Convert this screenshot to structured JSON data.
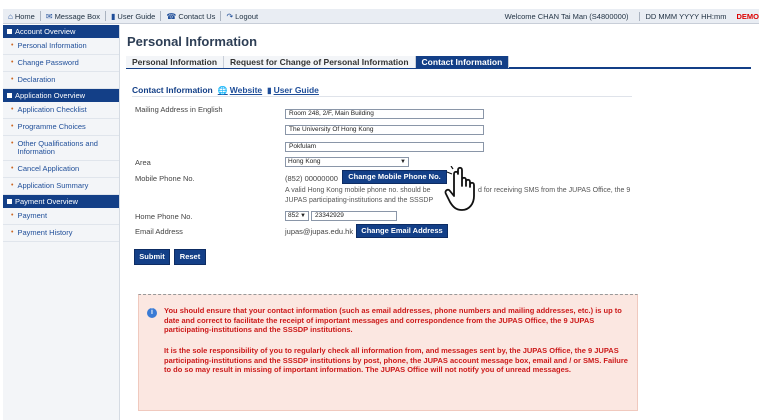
{
  "topbar": {
    "home": "Home",
    "message_box": "Message Box",
    "user_guide": "User Guide",
    "contact_us": "Contact Us",
    "logout": "Logout",
    "welcome": "Welcome CHAN Tai Man (S4800000)",
    "datetime": "DD MMM YYYY HH:mm",
    "demo": "DEMO"
  },
  "sidebar": {
    "sections": [
      {
        "title": "Account Overview",
        "items": [
          "Personal Information",
          "Change Password",
          "Declaration"
        ]
      },
      {
        "title": "Application Overview",
        "items": [
          "Application Checklist",
          "Programme Choices",
          "Other Qualifications and Information",
          "Cancel Application",
          "Application Summary"
        ]
      },
      {
        "title": "Payment Overview",
        "items": [
          "Payment",
          "Payment History"
        ]
      }
    ]
  },
  "main": {
    "title": "Personal Information",
    "tabs": [
      "Personal Information",
      "Request for Change of Personal Information",
      "Contact Information"
    ],
    "section_title": "Contact Information",
    "website_link": "Website",
    "user_guide_link": "User Guide",
    "mailing_label": "Mailing Address in English",
    "address_lines": [
      "Room 248, 2/F, Main Building",
      "The University Of Hong Kong",
      "Pokfulam"
    ],
    "area_label": "Area",
    "area_value": "Hong Kong",
    "mobile_label": "Mobile Phone No.",
    "mobile_value": "(852) 00000000",
    "change_mobile_btn": "Change Mobile Phone No.",
    "mobile_note_1": "A valid Hong Kong mobile phone no. should be",
    "mobile_note_1b": "d for receiving SMS from the JUPAS Office, the 9",
    "mobile_note_2": "JUPAS participating-institutions and the SSSDP",
    "home_label": "Home Phone No.",
    "home_code": "852",
    "home_value": "23342929",
    "email_label": "Email Address",
    "email_value": "jupas@jupas.edu.hk",
    "change_email_btn": "Change Email Address",
    "submit_btn": "Submit",
    "reset_btn": "Reset",
    "notice_1": "You should ensure that your contact information (such as email addresses, phone numbers and mailing addresses, etc.) is up to date and correct to facilitate the receipt of important messages and correspondence from the JUPAS Office, the 9 JUPAS participating-institutions and the SSSDP institutions.",
    "notice_2": "It is the sole responsibility of you to regularly check all information from, and messages sent by, the JUPAS Office, the 9 JUPAS participating-institutions and the SSSDP institutions by post, phone, the JUPAS account message box, email and / or SMS. Failure to do so may result in missing of important information. The JUPAS Office will not notify you of unread messages."
  },
  "colors": {
    "primary": "#133f87",
    "notice_bg": "#fbe7e1",
    "notice_text": "#cc1a1a"
  }
}
